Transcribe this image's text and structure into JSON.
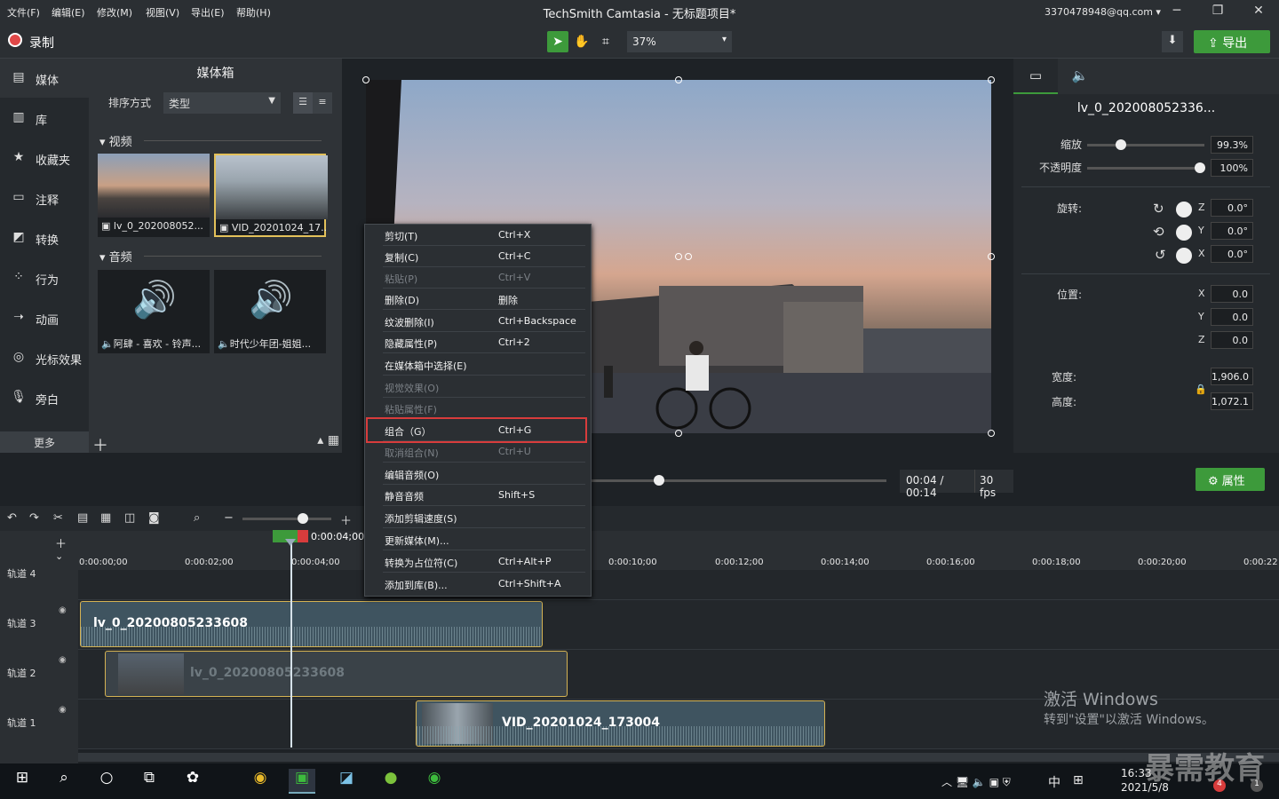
{
  "menubar": {
    "items": [
      "文件(F)",
      "编辑(E)",
      "修改(M)",
      "视图(V)",
      "导出(E)",
      "帮助(H)"
    ],
    "title": "TechSmith Camtasia - 无标题项目*",
    "account": "3370478948@qq.com ▾"
  },
  "toolbar": {
    "record": "录制",
    "zoom": "37%",
    "export": "导出",
    "zoom_arrow": "▾"
  },
  "sidebar": {
    "items": [
      {
        "label": "媒体",
        "icon": "media-icon"
      },
      {
        "label": "库",
        "icon": "library-icon"
      },
      {
        "label": "收藏夹",
        "icon": "star-icon"
      },
      {
        "label": "注释",
        "icon": "annotation-icon"
      },
      {
        "label": "转换",
        "icon": "transition-icon"
      },
      {
        "label": "行为",
        "icon": "behavior-icon"
      },
      {
        "label": "动画",
        "icon": "animation-icon"
      },
      {
        "label": "光标效果",
        "icon": "cursor-icon"
      },
      {
        "label": "旁白",
        "icon": "mic-icon"
      }
    ],
    "more": "更多"
  },
  "media_bin": {
    "title": "媒体箱",
    "sort_label": "排序方式",
    "sort_value": "类型",
    "video_section": "视频",
    "audio_section": "音频",
    "videos": [
      "lv_0_202008052...",
      "VID_20201024_17..."
    ],
    "audios": [
      "阿肆 - 喜欢 - 铃声...",
      "时代少年团-姐姐..."
    ]
  },
  "properties": {
    "clip_name": "lv_0_202008052336...",
    "scale_label": "缩放",
    "scale": "99.3%",
    "scale_level": 0.25,
    "opacity_label": "不透明度",
    "opacity": "100%",
    "opacity_level": 1.0,
    "rotation_label": "旋转:",
    "rot_z": "0.0°",
    "rot_y": "0.0°",
    "rot_x": "0.0°",
    "position_label": "位置:",
    "pos_x": "0.0",
    "pos_y": "0.0",
    "pos_z": "0.0",
    "width_label": "宽度:",
    "width": "1,906.0",
    "height_label": "高度:",
    "height": "1,072.1",
    "axis_z": "Z",
    "axis_y": "Y",
    "axis_x": "X",
    "props_button": "属性"
  },
  "playback": {
    "timecode": "00:04 / 00:14",
    "fps": "30 fps"
  },
  "timeline": {
    "playhead_time": "0:00:04;00",
    "ticks": [
      "0:00:00;00",
      "0:00:02;00",
      "0:00:04;00",
      "0:00:10;00",
      "0:00:12;00",
      "0:00:14;00",
      "0:00:16;00",
      "0:00:18;00",
      "0:00:20;00",
      "0:00:22"
    ],
    "tracks": [
      "轨道 4",
      "轨道 3",
      "轨道 2",
      "轨道 1"
    ],
    "clips": [
      "lv_0_20200805233608",
      "lv_0_20200805233608",
      "VID_20201024_173004"
    ]
  },
  "context_menu": {
    "items": [
      {
        "label": "剪切(T)",
        "shortcut": "Ctrl+X",
        "disabled": false
      },
      {
        "label": "复制(C)",
        "shortcut": "Ctrl+C",
        "disabled": false
      },
      {
        "label": "粘贴(P)",
        "shortcut": "Ctrl+V",
        "disabled": true
      },
      {
        "label": "删除(D)",
        "shortcut": "删除",
        "disabled": false
      },
      {
        "label": "纹波删除(I)",
        "shortcut": "Ctrl+Backspace",
        "disabled": false
      },
      {
        "label": "隐藏属性(P)",
        "shortcut": "Ctrl+2",
        "disabled": false
      },
      {
        "label": "在媒体箱中选择(E)",
        "shortcut": "",
        "disabled": false
      },
      {
        "label": "视觉效果(O)",
        "shortcut": "",
        "disabled": true
      },
      {
        "label": "粘贴属性(F)",
        "shortcut": "",
        "disabled": true
      },
      {
        "label": "组合（G）",
        "shortcut": "Ctrl+G",
        "disabled": false
      },
      {
        "label": "取消组合(N)",
        "shortcut": "Ctrl+U",
        "disabled": true
      },
      {
        "label": "编辑音频(O)",
        "shortcut": "",
        "disabled": false
      },
      {
        "label": "静音音频",
        "shortcut": "Shift+S",
        "disabled": false
      },
      {
        "label": "添加剪辑速度(S)",
        "shortcut": "",
        "disabled": false
      },
      {
        "label": "更新媒体(M)...",
        "shortcut": "",
        "disabled": false
      },
      {
        "label": "转换为占位符(C)",
        "shortcut": "Ctrl+Alt+P",
        "disabled": false
      },
      {
        "label": "添加到库(B)...",
        "shortcut": "Ctrl+Shift+A",
        "disabled": false
      }
    ]
  },
  "watermark": {
    "line1": "激活 Windows",
    "line2": "转到\"设置\"以激活 Windows。"
  },
  "taskbar": {
    "time": "16:33",
    "date": "2021/5/8",
    "ime": "中",
    "brand": "暴需教育",
    "badge1": "4",
    "badge2": "1"
  },
  "colors": {
    "accent": "#3d9a3b",
    "highlight": "#d83c3c",
    "clip_border": "#d4b253"
  }
}
